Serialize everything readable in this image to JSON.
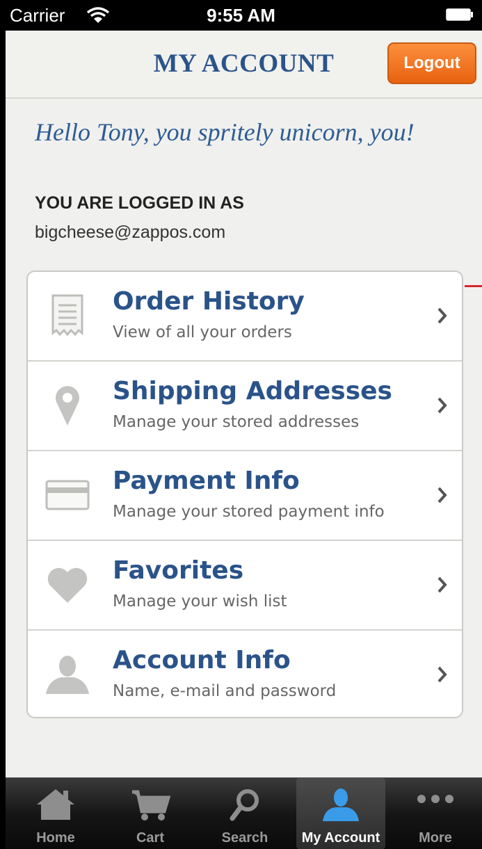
{
  "status_bar": {
    "carrier": "Carrier",
    "time": "9:55 AM"
  },
  "nav": {
    "title": "MY ACCOUNT",
    "logout_label": "Logout"
  },
  "greeting": "Hello Tony, you spritely unicorn, you!",
  "account": {
    "logged_in_label": "YOU ARE LOGGED IN AS",
    "email": "bigcheese@zappos.com"
  },
  "menu": [
    {
      "title": "Order History",
      "subtitle": "View of all your orders",
      "icon": "receipt-icon"
    },
    {
      "title": "Shipping Addresses",
      "subtitle": "Manage your stored addresses",
      "icon": "map-pin-icon"
    },
    {
      "title": "Payment Info",
      "subtitle": "Manage your stored payment info",
      "icon": "credit-card-icon"
    },
    {
      "title": "Favorites",
      "subtitle": "Manage your wish list",
      "icon": "heart-icon"
    },
    {
      "title": "Account Info",
      "subtitle": "Name, e-mail and password",
      "icon": "person-icon"
    }
  ],
  "tabs": [
    {
      "label": "Home",
      "icon": "home-icon",
      "active": false
    },
    {
      "label": "Cart",
      "icon": "cart-icon",
      "active": false
    },
    {
      "label": "Search",
      "icon": "search-icon",
      "active": false
    },
    {
      "label": "My Account",
      "icon": "person-icon",
      "active": true
    },
    {
      "label": "More",
      "icon": "more-icon",
      "active": false
    }
  ],
  "colors": {
    "brand_blue": "#2a5389",
    "logout_orange": "#f07a25",
    "active_tab_icon": "#3a9be8"
  }
}
